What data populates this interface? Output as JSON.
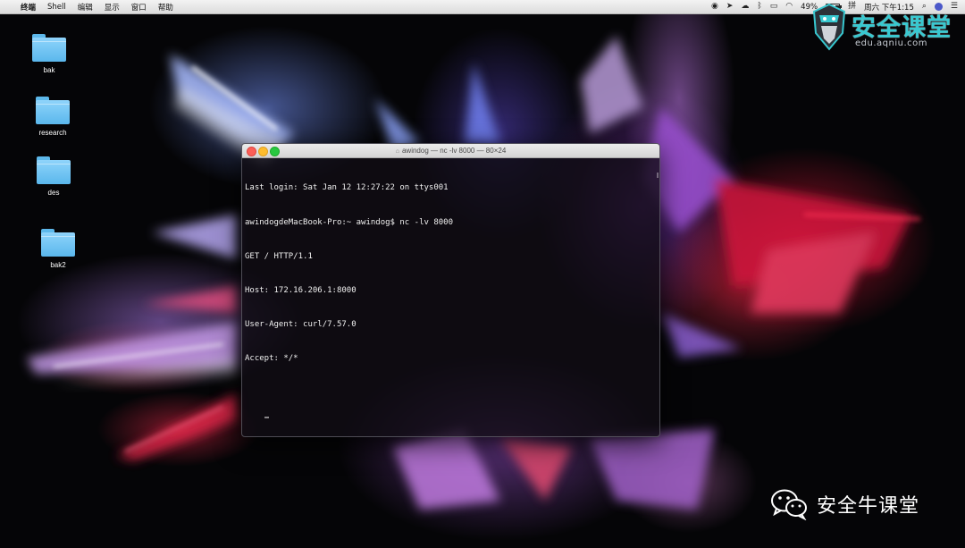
{
  "menubar": {
    "app_name": "终端",
    "menus": [
      "Shell",
      "编辑",
      "显示",
      "窗口",
      "帮助"
    ],
    "battery_percent": "49%",
    "battery_level": 0.49,
    "clock": "周六 下午1:15"
  },
  "desktop": {
    "icons": [
      {
        "label": "bak",
        "icon": "folder-icon"
      },
      {
        "label": "research",
        "icon": "folder-icon"
      },
      {
        "label": "des",
        "icon": "folder-icon"
      },
      {
        "label": "bak2",
        "icon": "folder-icon"
      }
    ]
  },
  "terminal": {
    "title": "awindog — nc -lv 8000 — 80×24",
    "lines": [
      "Last login: Sat Jan 12 12:27:22 on ttys001",
      "awindogdeMacBook-Pro:~ awindog$ nc -lv 8000",
      "GET / HTTP/1.1",
      "Host: 172.16.206.1:8000",
      "User-Agent: curl/7.57.0",
      "Accept: */*"
    ]
  },
  "watermark": {
    "brand_title": "安全课堂",
    "brand_url": "edu.aqniu.com",
    "wechat_label": "安全牛课堂",
    "brand_color": "#38c8d0"
  }
}
